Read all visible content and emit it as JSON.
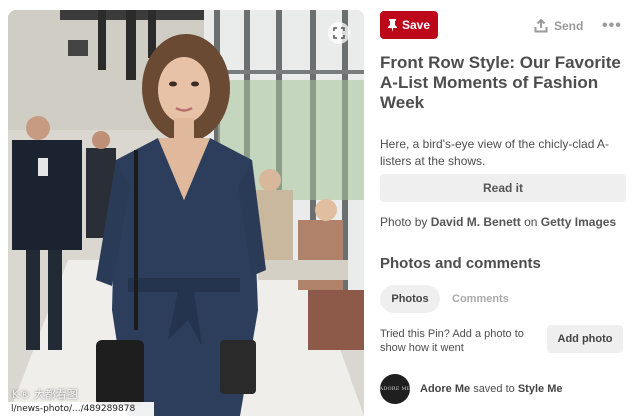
{
  "photo": {
    "watermark_logo": "K® 大都看图",
    "status_url": "l/news-photo/.../489289878"
  },
  "actions": {
    "save_label": "Save",
    "send_label": "Send",
    "more_label": "•••"
  },
  "pin": {
    "title": "Front Row Style: Our Favorite A-List Moments of Fashion Week",
    "description": "Here, a bird's-eye view of the chicly-clad A-listers at the shows.",
    "read_it_label": "Read it",
    "credit_prefix": "Photo by",
    "credit_author": "David M. Benett",
    "credit_mid": "on",
    "credit_source": "Getty Images"
  },
  "comments": {
    "section_title": "Photos and comments",
    "tabs": [
      "Photos",
      "Comments"
    ],
    "prompt": "Tried this Pin? Add a photo to show how it went",
    "add_photo_label": "Add photo"
  },
  "saved_by": {
    "avatar_text": "ADORE ME",
    "user": "Adore Me",
    "verb": "saved to",
    "board": "Style Me"
  },
  "colors": {
    "save_red": "#bd081c",
    "button_gray": "#efefef",
    "text": "#4d4d4d"
  }
}
